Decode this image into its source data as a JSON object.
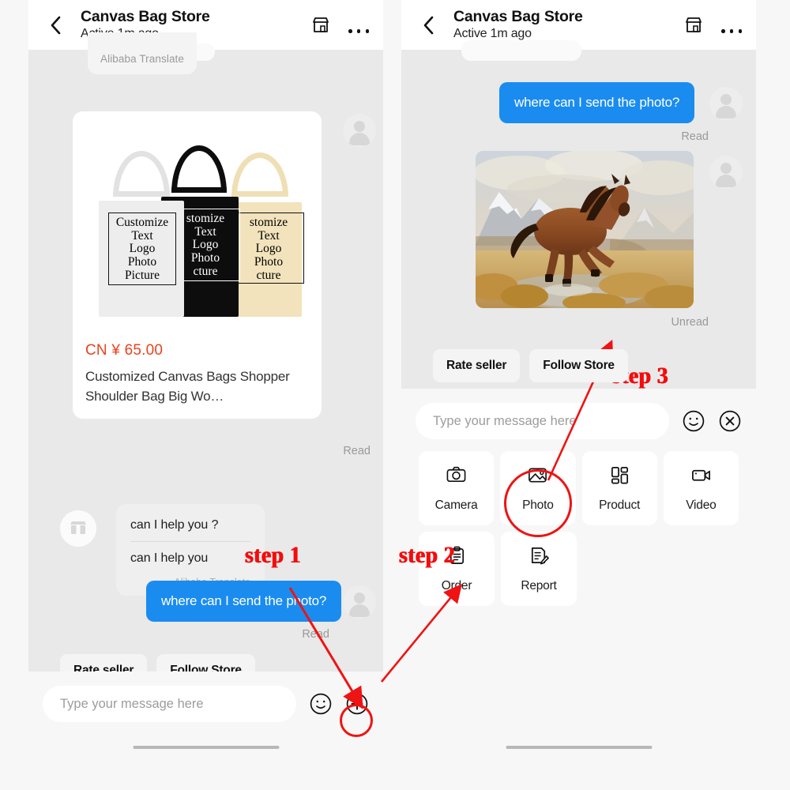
{
  "header": {
    "back_icon": "chevron-left-icon",
    "title": "Canvas Bag Store",
    "subtitle": "Active 1m ago",
    "store_icon": "storefront-icon",
    "more_icon": "more-horizontal-icon"
  },
  "left_panel": {
    "translate_chip": "Alibaba Translate",
    "product_card": {
      "price": "CN ¥ 65.00",
      "title": "Customized Canvas Bags Shopper Shoulder Bag Big Wo…",
      "bag_label_lines": [
        "Customize",
        "Text",
        "Logo",
        "Photo",
        "Picture"
      ],
      "bag_colors": [
        "white",
        "black",
        "beige"
      ]
    },
    "product_receipt": "Read",
    "seller_message": {
      "line1": "can I help you ?",
      "line2": "can I help you",
      "translate": "Alibaba Translate"
    },
    "user_message": "where can I send the photo?",
    "user_receipt": "Read",
    "quick_actions": [
      "Rate seller",
      "Follow Store"
    ],
    "composer": {
      "placeholder": "Type your message here",
      "value": "",
      "emoji_icon": "smiley-icon",
      "plus_icon": "plus-circle-icon"
    }
  },
  "right_panel": {
    "user_message": "where can I send the photo?",
    "user_receipt": "Read",
    "photo_message": {
      "alt": "brown horse running in meadow with mountains",
      "receipt": "Unread"
    },
    "quick_actions": [
      "Rate seller",
      "Follow Store"
    ],
    "composer": {
      "placeholder": "Type your message here",
      "value": "",
      "emoji_icon": "smiley-icon",
      "close_icon": "close-circle-icon"
    },
    "attachments": [
      {
        "label": "Camera",
        "icon": "camera-icon"
      },
      {
        "label": "Photo",
        "icon": "image-icon"
      },
      {
        "label": "Product",
        "icon": "grid-layout-icon"
      },
      {
        "label": "Video",
        "icon": "video-camera-icon"
      },
      {
        "label": "Order",
        "icon": "clipboard-icon"
      },
      {
        "label": "Report",
        "icon": "document-edit-icon"
      }
    ]
  },
  "annotations": {
    "step1": "step 1",
    "step2": "step 2",
    "step3": "step 3",
    "color": "#f40c0c"
  }
}
